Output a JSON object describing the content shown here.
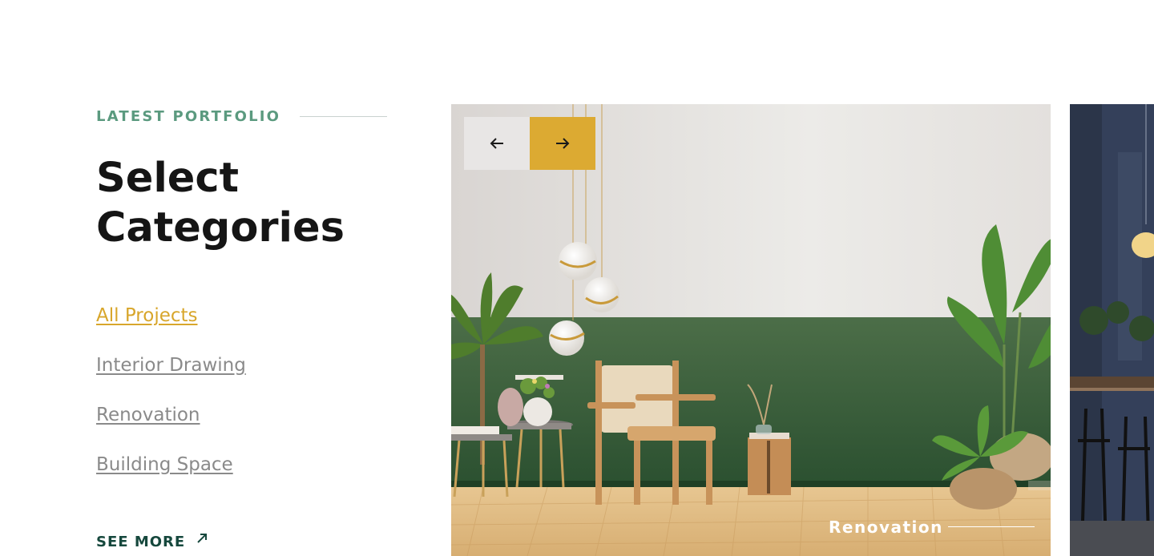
{
  "section": {
    "eyebrow": "LATEST PORTFOLIO",
    "title": "Select Categories"
  },
  "categories": [
    {
      "label": "All Projects",
      "active": true
    },
    {
      "label": "Interior Drawing",
      "active": false
    },
    {
      "label": "Renovation",
      "active": false
    },
    {
      "label": "Building Space",
      "active": false
    }
  ],
  "see_more": {
    "label": "SEE MORE",
    "icon": "arrow-up-right-icon"
  },
  "slider": {
    "prev_icon": "arrow-left-icon",
    "next_icon": "arrow-right-icon",
    "current_caption": "Renovation"
  },
  "colors": {
    "accent": "#dcaa32",
    "eyebrow": "#5b9a7f",
    "dark_green": "#16483d",
    "muted_text": "#8a8a8a"
  }
}
